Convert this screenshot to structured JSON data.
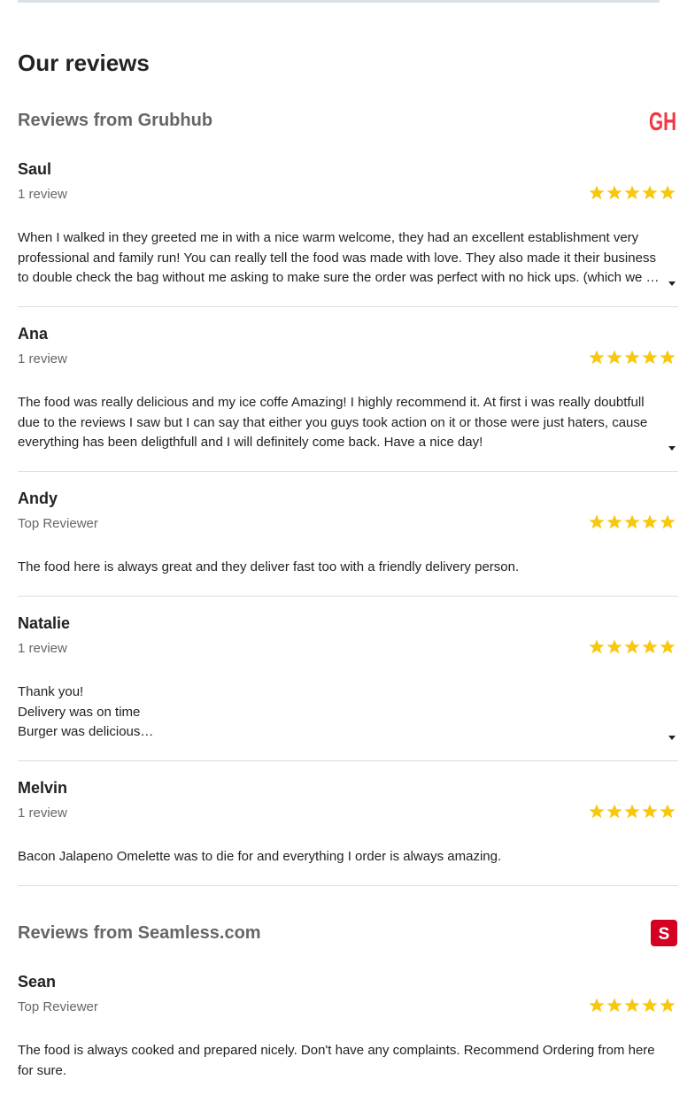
{
  "page": {
    "heading": "Our reviews"
  },
  "colors": {
    "star": "#F9C70C",
    "grubhub": "#F63440",
    "seamless": "#D40123",
    "muted_text": "#666666"
  },
  "sources": [
    {
      "title": "Reviews from Grubhub",
      "logo": {
        "icon": "grubhub-logo",
        "text": "GH"
      },
      "reviews": [
        {
          "name": "Saul",
          "meta": "1 review",
          "rating": 5,
          "text": "When I walked in they greeted me in with a nice warm welcome, they had an excellent establishment very professional and family run! You can really tell the food was made with love. They also made it their business to double check the bag without me asking to make sure the order was perfect with no hick ups. (which we …",
          "expandable": true
        },
        {
          "name": "Ana",
          "meta": "1 review",
          "rating": 5,
          "text": "The food was really delicious and my ice coffe Amazing! I highly recommend it. At first i was really doubtfull due to the reviews I saw but I can say that either you guys took action on it or those were just haters, cause everything has been deligthfull and I will definitely come back. Have a nice day!",
          "expandable": true
        },
        {
          "name": "Andy",
          "meta": "Top Reviewer",
          "rating": 5,
          "text": "The food here is always great and they deliver fast too with a friendly delivery person.",
          "expandable": false
        },
        {
          "name": "Natalie",
          "meta": "1 review",
          "rating": 5,
          "text": "Thank you!\nDelivery was on time\nBurger was delicious…",
          "expandable": true
        },
        {
          "name": "Melvin",
          "meta": "1 review",
          "rating": 5,
          "text": "Bacon Jalapeno Omelette was to die for and everything I order is always amazing.",
          "expandable": false
        }
      ]
    },
    {
      "title": "Reviews from Seamless.com",
      "logo": {
        "icon": "seamless-logo",
        "text": "S"
      },
      "reviews": [
        {
          "name": "Sean",
          "meta": "Top Reviewer",
          "rating": 5,
          "text": "The food is always cooked and prepared nicely. Don't have any complaints. Recommend Ordering from here for sure.",
          "expandable": false
        }
      ]
    }
  ]
}
